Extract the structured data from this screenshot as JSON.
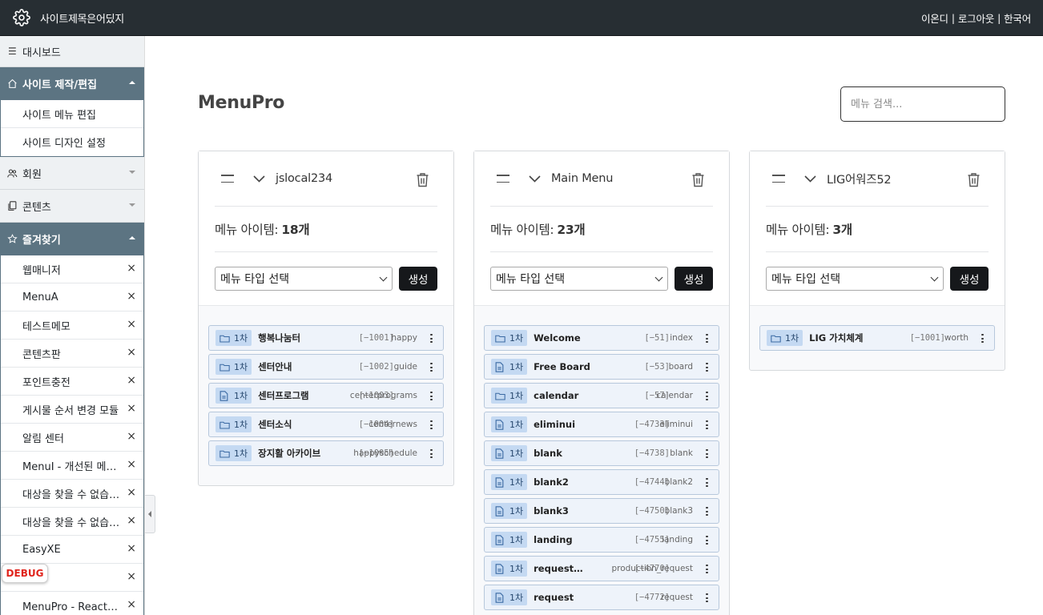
{
  "header": {
    "site_title": "사이트제목은어딨지",
    "user": "이온디",
    "logout": "로그아웃",
    "language": "한국어",
    "separator": "|"
  },
  "sidebar": {
    "dashboard": "대시보드",
    "groups": {
      "site": {
        "label": "사이트 제작/편집",
        "items": [
          "사이트 메뉴 편집",
          "사이트 디자인 설정"
        ]
      },
      "member": {
        "label": "회원"
      },
      "content": {
        "label": "콘텐츠"
      },
      "favorites": {
        "label": "즐겨찾기",
        "items": [
          "웹매니저",
          "MenuA",
          "테스트메모",
          "콘텐츠판",
          "포인트충전",
          "게시물 순서 변경 모듈",
          "알림 센터",
          "MenuI - 개선된 메뉴 관리",
          "대상을 찾을 수 없습니다",
          "대상을 찾을 수 없습니다",
          "EasyXE",
          "",
          "MenuPro - React 메뉴 관리"
        ],
        "remove_icon": "×"
      }
    },
    "debug_label": "DEBUG"
  },
  "main": {
    "title": "MenuPro",
    "search_placeholder": "메뉴 검색..."
  },
  "cards": [
    {
      "name": "jslocal234",
      "count_label": "메뉴 아이템:",
      "count": "18개",
      "select_placeholder": "메뉴 타입 선택",
      "create_label": "생성",
      "items": [
        {
          "level": "1차",
          "icon": "folder-icon",
          "name": "행복나눔터",
          "id": "[−1001]",
          "slug": "happy"
        },
        {
          "level": "1차",
          "icon": "folder-icon",
          "name": "센터안내",
          "id": "[−1002]",
          "slug": "guide"
        },
        {
          "level": "1차",
          "icon": "document-icon",
          "name": "센터프로그램",
          "id": "[−1003]",
          "slug": "centerprograms"
        },
        {
          "level": "1차",
          "icon": "folder-icon",
          "name": "센터소식",
          "id": "[−1004]",
          "slug": "centernews"
        },
        {
          "level": "1차",
          "icon": "folder-icon",
          "name": "장지활 아카이브",
          "id": "[−1005]",
          "slug": "happyschedule"
        }
      ]
    },
    {
      "name": "Main Menu",
      "count_label": "메뉴 아이템:",
      "count": "23개",
      "select_placeholder": "메뉴 타입 선택",
      "create_label": "생성",
      "items": [
        {
          "level": "1차",
          "icon": "folder-icon",
          "name": "Welcome",
          "id": "[−51]",
          "slug": "index"
        },
        {
          "level": "1차",
          "icon": "document-icon",
          "name": "Free Board",
          "id": "[−53]",
          "slug": "board"
        },
        {
          "level": "1차",
          "icon": "folder-icon",
          "name": "calendar",
          "id": "[−57]",
          "slug": "calendar"
        },
        {
          "level": "1차",
          "icon": "document-icon",
          "name": "eliminui",
          "id": "[−4733]",
          "slug": "eliminui"
        },
        {
          "level": "1차",
          "icon": "document-icon",
          "name": "blank",
          "id": "[−4738]",
          "slug": "blank"
        },
        {
          "level": "1차",
          "icon": "document-icon",
          "name": "blank2",
          "id": "[−4744]",
          "slug": "blank2"
        },
        {
          "level": "1차",
          "icon": "document-icon",
          "name": "blank3",
          "id": "[−4750]",
          "slug": "blank3"
        },
        {
          "level": "1차",
          "icon": "document-icon",
          "name": "landing",
          "id": "[−4755]",
          "slug": "landing"
        },
        {
          "level": "1차",
          "icon": "document-icon",
          "name": "request…",
          "id": "[−4770]",
          "slug": "production_request"
        },
        {
          "level": "1차",
          "icon": "document-icon",
          "name": "request",
          "id": "[−4772]",
          "slug": "request"
        }
      ]
    },
    {
      "name": "LIG어워즈52",
      "count_label": "메뉴 아이템:",
      "count": "3개",
      "select_placeholder": "메뉴 타입 선택",
      "create_label": "생성",
      "items": [
        {
          "level": "1차",
          "icon": "folder-icon",
          "name": "LIG 가치체계",
          "id": "[−1001]",
          "slug": "worth"
        }
      ]
    }
  ]
}
